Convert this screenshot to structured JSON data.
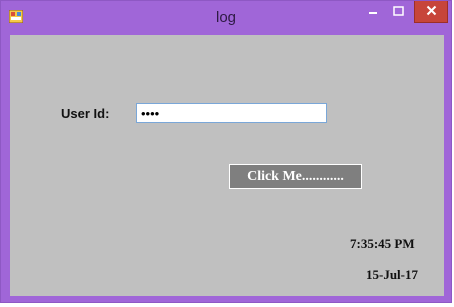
{
  "window": {
    "title": "log",
    "controls": {
      "minimize": "minimize-icon",
      "maximize": "maximize-icon",
      "close": "close-icon"
    }
  },
  "form": {
    "userid_label": "User Id:",
    "userid_value": "••••",
    "button_label": "Click Me............",
    "time": "7:35:45 PM",
    "date": "15-Jul-17"
  },
  "colors": {
    "frame": "#a066d8",
    "client": "#c0c0c0",
    "button": "#7f7f7f",
    "close": "#c7453a"
  }
}
